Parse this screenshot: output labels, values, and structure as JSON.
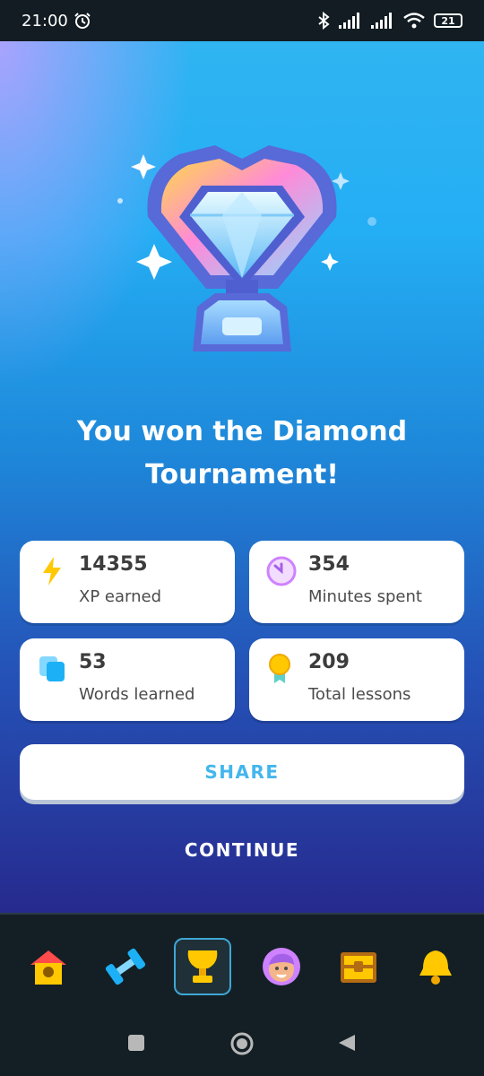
{
  "status_bar": {
    "time": "21:00",
    "battery": "21",
    "alarm_icon": "alarm-icon",
    "icons": [
      "bluetooth-icon",
      "signal-icon",
      "signal-icon",
      "wifi-icon",
      "battery-icon"
    ]
  },
  "headline": {
    "line1": "You won the Diamond",
    "line2": "Tournament!"
  },
  "stats": [
    {
      "value": "14355",
      "label": "XP earned",
      "icon": "lightning-icon",
      "color": "#ffc800"
    },
    {
      "value": "354",
      "label": "Minutes spent",
      "icon": "clock-icon",
      "color": "#ce82ff"
    },
    {
      "value": "53",
      "label": "Words learned",
      "icon": "cards-icon",
      "color": "#1cb0f6"
    },
    {
      "value": "209",
      "label": "Total lessons",
      "icon": "medal-icon",
      "color": "#ffc800"
    }
  ],
  "buttons": {
    "share": "SHARE",
    "continue": "CONTINUE"
  },
  "tabs": [
    {
      "icon": "home-icon",
      "active": false
    },
    {
      "icon": "dumbbell-icon",
      "active": false
    },
    {
      "icon": "trophy-icon",
      "active": true
    },
    {
      "icon": "profile-icon",
      "active": false
    },
    {
      "icon": "treasure-chest-icon",
      "active": false
    },
    {
      "icon": "bell-icon",
      "active": false
    }
  ],
  "colors": {
    "accent": "#1cb0f6",
    "share_text": "#44b6ec",
    "tab_highlight": "#3fa7d6"
  }
}
